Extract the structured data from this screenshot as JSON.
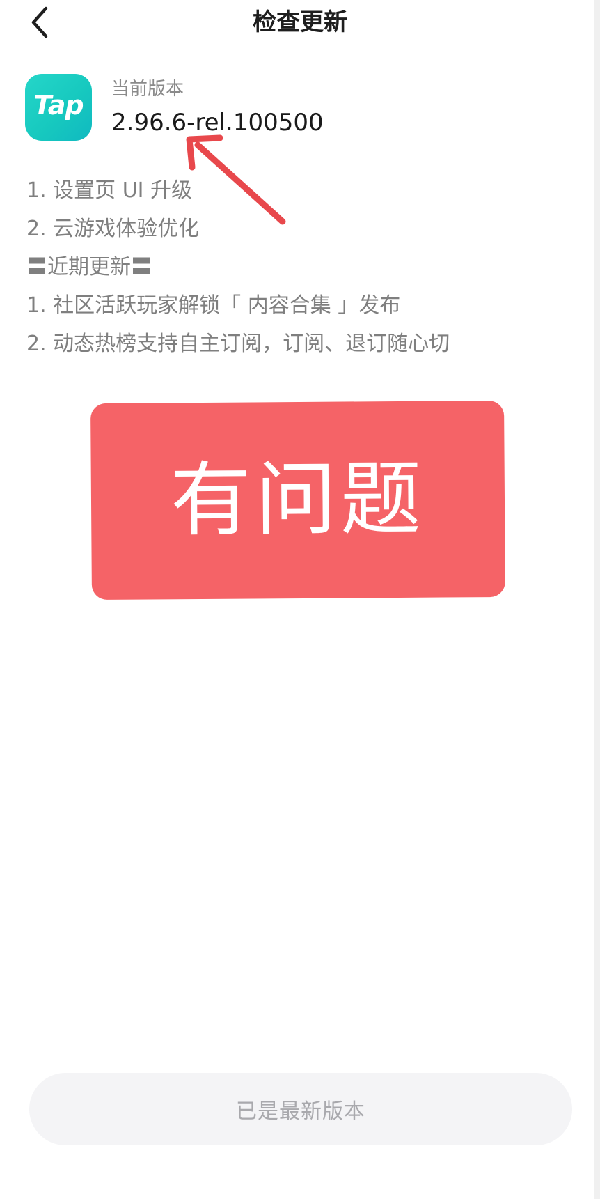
{
  "header": {
    "title": "检查更新",
    "back_icon": "chevron-left-icon"
  },
  "app": {
    "icon_text": "Tap",
    "icon_colors": [
      "#25d6c9",
      "#10b9c0"
    ],
    "version_label": "当前版本",
    "version_value": "2.96.6-rel.100500"
  },
  "annotation_arrow": {
    "icon": "arrow-annotation-icon",
    "color": "#e8484c"
  },
  "release_notes": [
    "1. 设置页 UI 升级",
    "2. 云游戏体验优化",
    "〓近期更新〓",
    "1. 社区活跃玩家解锁「 内容合集 」发布",
    "2. 动态热榜支持自主订阅，订阅、退订随心切"
  ],
  "banner": {
    "text": "有问题",
    "color": "#f56367"
  },
  "footer": {
    "status_label": "已是最新版本"
  }
}
